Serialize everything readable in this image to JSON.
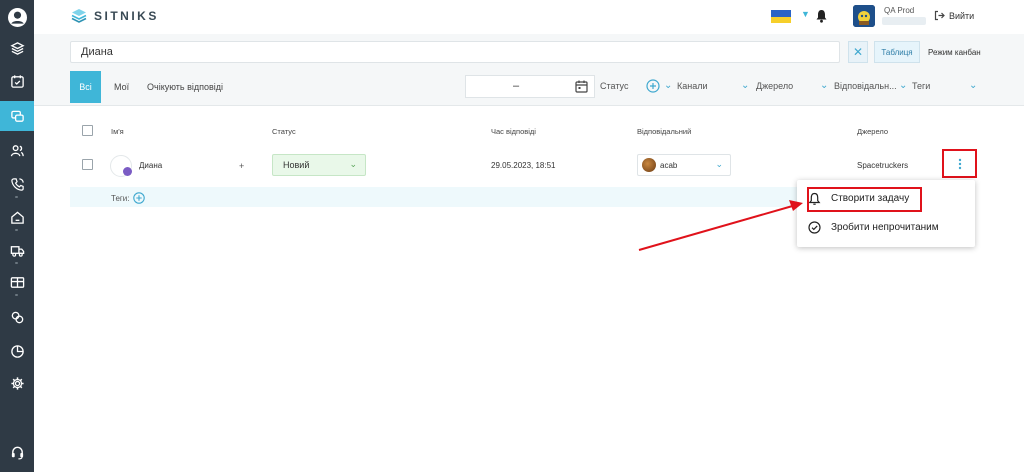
{
  "brand": {
    "name": "SITNIKS",
    "accent": "#3fb6d8",
    "sidebar_bg": "#2f3a45",
    "annotation_color": "#e0121b"
  },
  "header": {
    "user_name": "QA Prod",
    "logout_label": "Вийти"
  },
  "search": {
    "value": "Диана",
    "clear_label": "✕",
    "table_label": "Таблиця",
    "kanban_label": "Режим канбан"
  },
  "tabs": {
    "all": "Всі",
    "mine": "Мої",
    "waiting": "Очікують відповіді"
  },
  "filters": {
    "date_value": "–",
    "status": "Статус",
    "channels": "Канали",
    "source": "Джерело",
    "responsible": "Відповідальн...",
    "tags": "Теги"
  },
  "table": {
    "columns": {
      "name": "Ім'я",
      "status": "Статус",
      "reply_time": "Час відповіді",
      "responsible": "Відповідальний",
      "source": "Джерело"
    },
    "row": {
      "name": "Диана",
      "plus": "+",
      "status": "Новий",
      "reply_time": "29.05.2023, 18:51",
      "responsible": "acab",
      "source": "Spacetruckers"
    },
    "tags_label": "Теги:"
  },
  "menu": {
    "create_task": "Створити задачу",
    "mark_unread": "Зробити непрочитаним"
  }
}
